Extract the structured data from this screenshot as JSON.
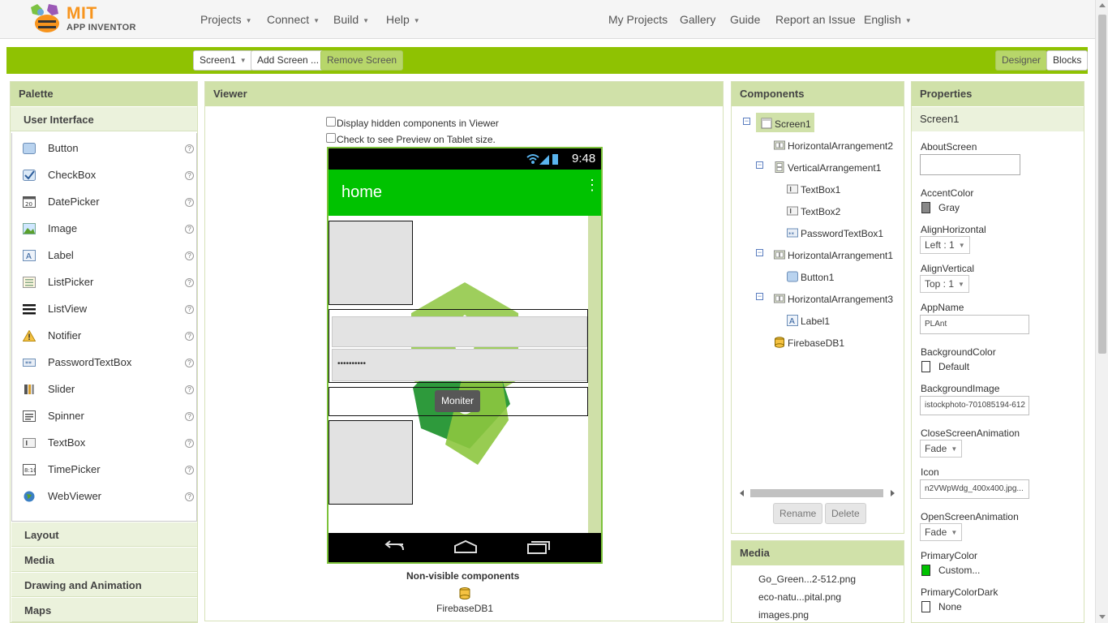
{
  "header": {
    "logo_mit": "MIT",
    "logo_sub": "APP INVENTOR",
    "menus": [
      "Projects",
      "Connect",
      "Build",
      "Help"
    ],
    "links": [
      "My Projects",
      "Gallery",
      "Guide",
      "Report an Issue",
      "English"
    ]
  },
  "toolbar": {
    "screen_select": "Screen1",
    "add_screen": "Add Screen ...",
    "remove_screen": "Remove Screen",
    "designer": "Designer",
    "blocks": "Blocks",
    "accent_color": "#8fc202"
  },
  "palette": {
    "title": "Palette",
    "open_category": "User Interface",
    "items": [
      "Button",
      "CheckBox",
      "DatePicker",
      "Image",
      "Label",
      "ListPicker",
      "ListView",
      "Notifier",
      "PasswordTextBox",
      "Slider",
      "Spinner",
      "TextBox",
      "TimePicker",
      "WebViewer"
    ],
    "help_glyph": "?",
    "categories": [
      "Layout",
      "Media",
      "Drawing and Animation",
      "Maps"
    ]
  },
  "viewer": {
    "title": "Viewer",
    "checkbox_hidden": "Display hidden components in Viewer",
    "checkbox_tablet": "Check to see Preview on Tablet size.",
    "phone": {
      "time": "9:48",
      "app_title": "home",
      "password_mask": "••••••••••",
      "button_label": "Moniter",
      "appbar_color": "#00c200"
    },
    "nonvisible_title": "Non-visible components",
    "nonvisible_items": [
      "FirebaseDB1"
    ]
  },
  "components": {
    "title": "Components",
    "tree": [
      {
        "label": "Screen1",
        "icon": "screen-icon"
      },
      {
        "label": "HorizontalArrangement2",
        "icon": "horizontal-arrangement-icon"
      },
      {
        "label": "VerticalArrangement1",
        "icon": "vertical-arrangement-icon"
      },
      {
        "label": "TextBox1",
        "icon": "textbox-icon"
      },
      {
        "label": "TextBox2",
        "icon": "textbox-icon"
      },
      {
        "label": "PasswordTextBox1",
        "icon": "password-textbox-icon"
      },
      {
        "label": "HorizontalArrangement1",
        "icon": "horizontal-arrangement-icon"
      },
      {
        "label": "Button1",
        "icon": "button-icon"
      },
      {
        "label": "HorizontalArrangement3",
        "icon": "horizontal-arrangement-icon"
      },
      {
        "label": "Label1",
        "icon": "label-icon"
      },
      {
        "label": "FirebaseDB1",
        "icon": "firebase-db-icon"
      }
    ],
    "rename": "Rename",
    "delete": "Delete"
  },
  "media": {
    "title": "Media",
    "items": [
      "Go_Green...2-512.png",
      "eco-natu...pital.png",
      "images.png"
    ]
  },
  "properties": {
    "title": "Properties",
    "component": "Screen1",
    "about_screen": {
      "label": "AboutScreen",
      "value": ""
    },
    "accent_color": {
      "label": "AccentColor",
      "value": "Gray",
      "color": "#888888"
    },
    "align_horizontal": {
      "label": "AlignHorizontal",
      "value": "Left : 1"
    },
    "align_vertical": {
      "label": "AlignVertical",
      "value": "Top : 1"
    },
    "app_name": {
      "label": "AppName",
      "value": "PLAnt"
    },
    "background_color": {
      "label": "BackgroundColor",
      "value": "Default",
      "color": "#ffffff"
    },
    "background_image": {
      "label": "BackgroundImage",
      "value": "istockphoto-701085194-612"
    },
    "close_screen_animation": {
      "label": "CloseScreenAnimation",
      "value": "Fade"
    },
    "icon": {
      "label": "Icon",
      "value": "n2VWpWdg_400x400.jpg..."
    },
    "open_screen_animation": {
      "label": "OpenScreenAnimation",
      "value": "Fade"
    },
    "primary_color": {
      "label": "PrimaryColor",
      "value": "Custom...",
      "color": "#00c200"
    },
    "primary_color_dark": {
      "label": "PrimaryColorDark",
      "value": "None",
      "color": "#ffffff"
    }
  }
}
